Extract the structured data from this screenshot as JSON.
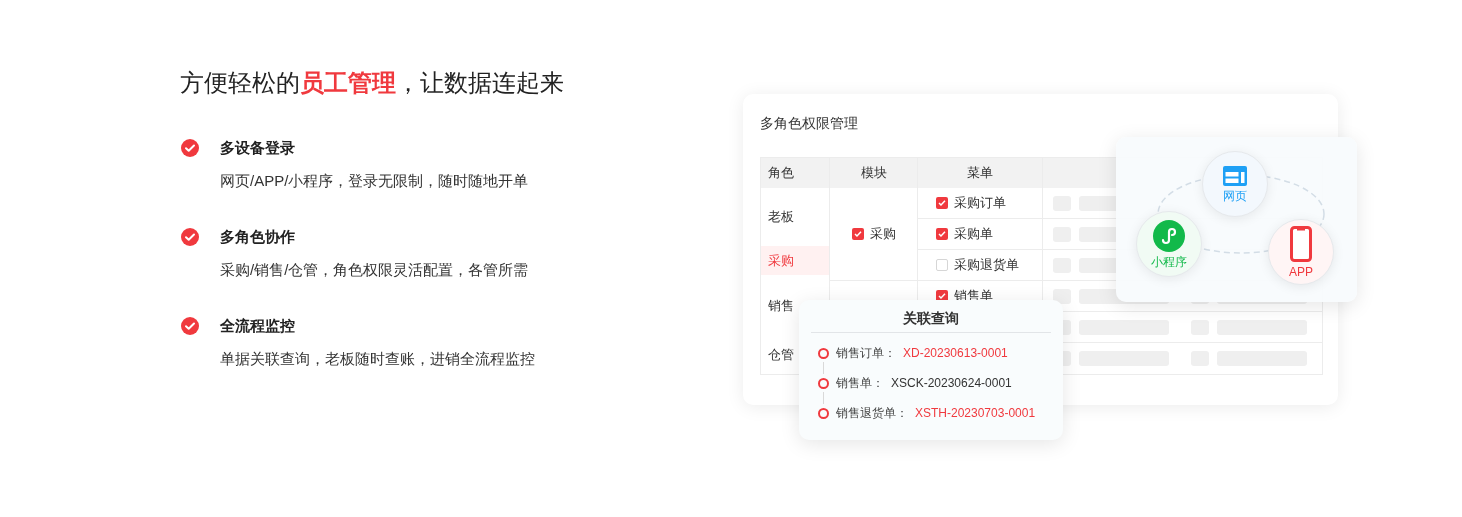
{
  "headline": "方便轻松的**员工管理**，让数据连起来",
  "features": [
    {
      "title": "多设备登录",
      "description": "网页/APP/小程序，登录无限制，随时随地开单"
    },
    {
      "title": "多角色协作",
      "description": "采购/销售/仓管，角色权限灵活配置，各管所需"
    },
    {
      "title": "全流程监控",
      "description": "单据关联查询，老板随时查账，进销全流程监控"
    }
  ],
  "permission_card": {
    "title": "多角色权限管理",
    "columns": [
      "角色",
      "模块",
      "菜单"
    ],
    "roles": [
      {
        "label": "老板",
        "selected": false
      },
      {
        "label": "采购",
        "selected": true
      },
      {
        "label": "销售",
        "selected": false
      },
      {
        "label": "仓管",
        "selected": false
      }
    ],
    "modules": [
      {
        "label": "采购",
        "checked": true
      }
    ],
    "menus": [
      {
        "label": "采购订单",
        "checked": true
      },
      {
        "label": "采购单",
        "checked": true
      },
      {
        "label": "采购退货单",
        "checked": false
      },
      {
        "label": "销售单",
        "checked": true
      }
    ]
  },
  "devices": [
    {
      "kind": "web",
      "label": "网页"
    },
    {
      "kind": "miniprogram",
      "label": "小程序"
    },
    {
      "kind": "app",
      "label": "APP"
    }
  ],
  "related_query": {
    "title": "关联查询",
    "items": [
      {
        "label": "销售订单：",
        "value": "XD-20230613-0001",
        "highlighted": true
      },
      {
        "label": "销售单：",
        "value": "XSCK-20230624-0001",
        "highlighted": false
      },
      {
        "label": "销售退货单：",
        "value": "XSTH-20230703-0001",
        "highlighted": true
      }
    ]
  }
}
